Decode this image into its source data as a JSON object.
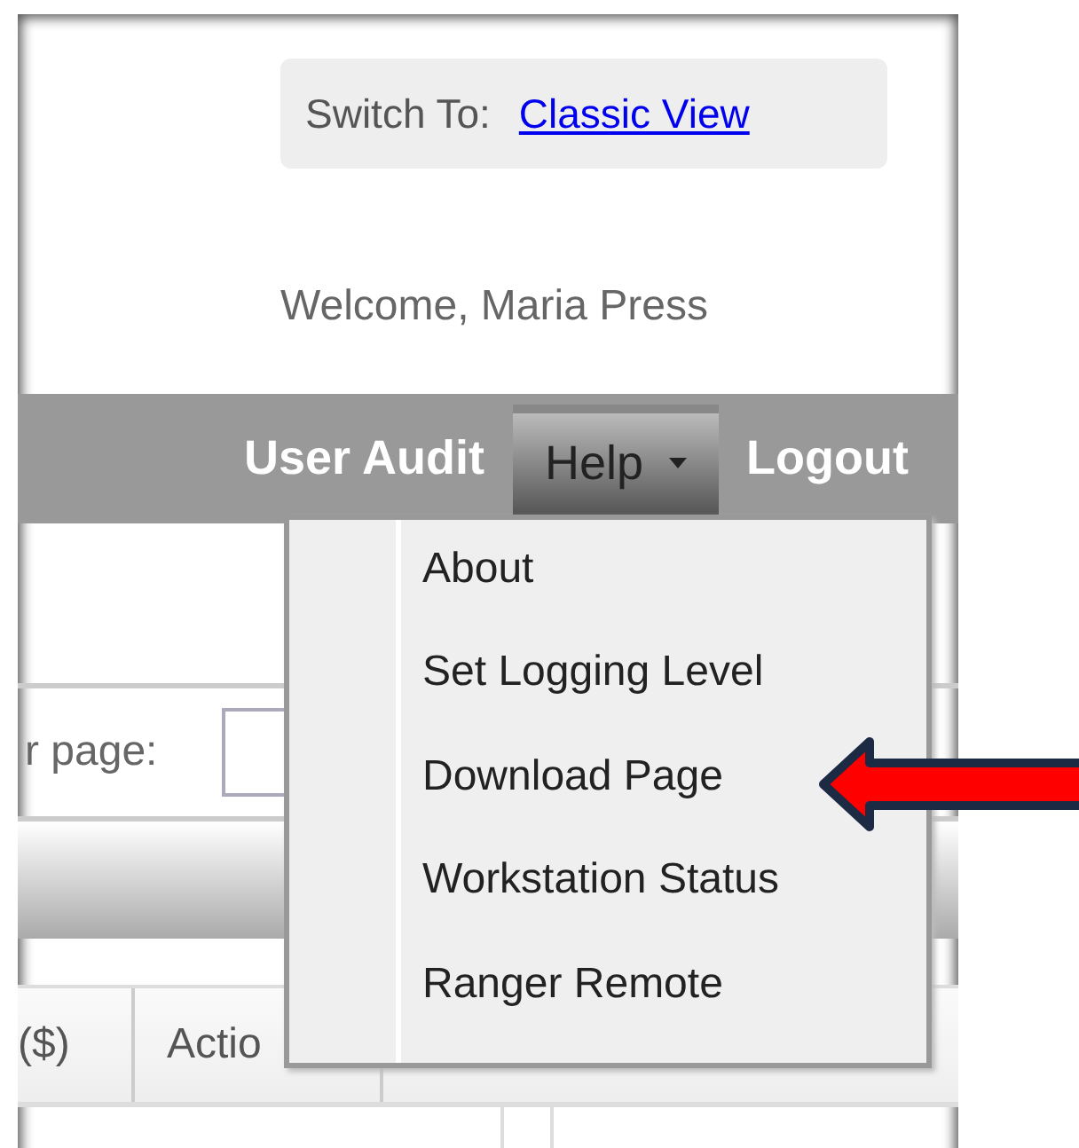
{
  "header": {
    "switch_label": "Switch To:",
    "switch_link": "Classic View",
    "welcome": "Welcome, Maria Press"
  },
  "nav": [
    {
      "label": "User Audit",
      "selected": false,
      "has_dropdown": false
    },
    {
      "label": "Help",
      "selected": true,
      "has_dropdown": true
    },
    {
      "label": "Logout",
      "selected": false,
      "has_dropdown": false
    }
  ],
  "page_size_label": "r page:",
  "table": {
    "columns": [
      "($)",
      "Actio"
    ]
  },
  "help_menu": {
    "items": [
      "About",
      "Set Logging Level",
      "Download Page",
      "Workstation Status",
      "Ranger Remote"
    ]
  }
}
